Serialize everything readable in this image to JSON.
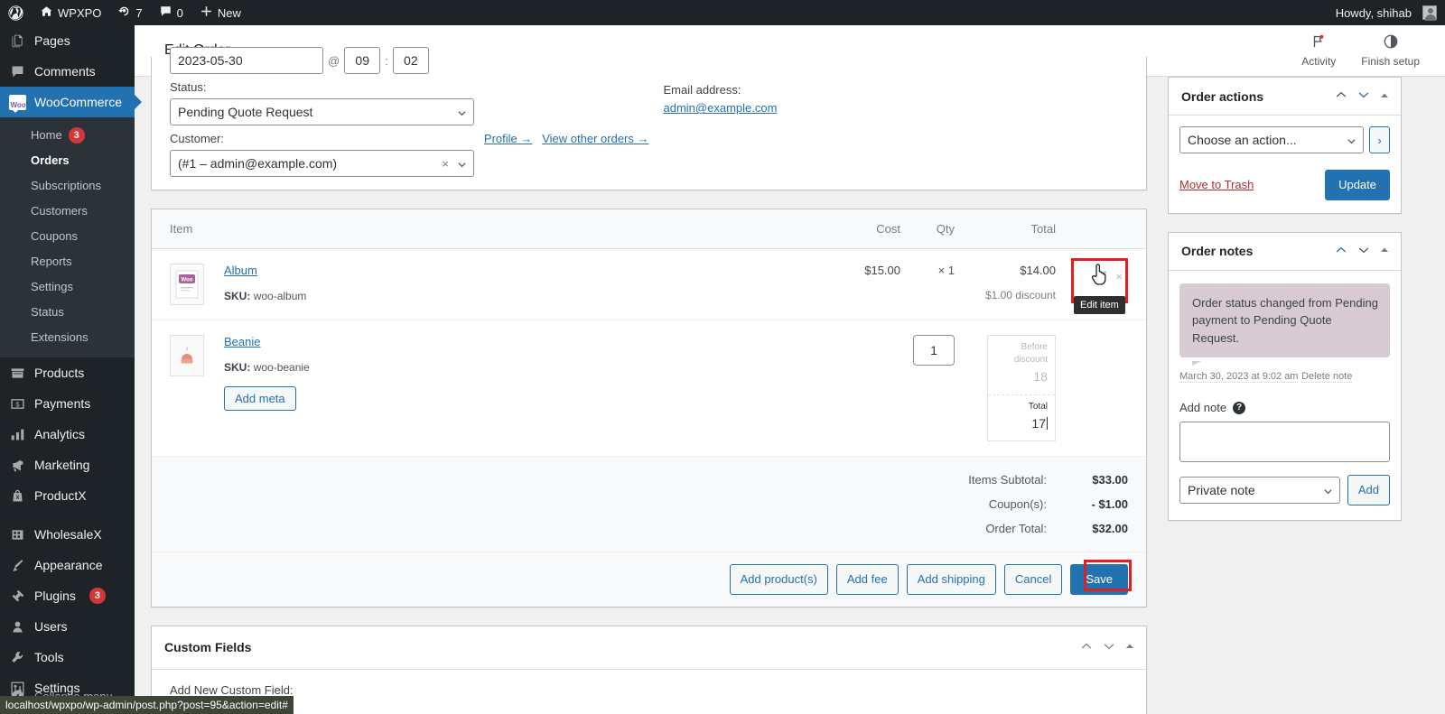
{
  "adminbar": {
    "logo_icon": "wordpress-logo-icon",
    "site_name": "WPXPO",
    "updates_count": "7",
    "comments_count": "0",
    "new_label": "New",
    "howdy": "Howdy, shihab"
  },
  "sidebar": {
    "top_items": [
      {
        "label": "Pages",
        "icon": "pages-icon"
      },
      {
        "label": "Comments",
        "icon": "comments-icon"
      }
    ],
    "woocommerce": {
      "label": "WooCommerce",
      "icon": "woo-icon",
      "submenu": [
        {
          "label": "Home",
          "badge": "3"
        },
        {
          "label": "Orders",
          "badge": ""
        },
        {
          "label": "Subscriptions",
          "badge": ""
        },
        {
          "label": "Customers",
          "badge": ""
        },
        {
          "label": "Coupons",
          "badge": ""
        },
        {
          "label": "Reports",
          "badge": ""
        },
        {
          "label": "Settings",
          "badge": ""
        },
        {
          "label": "Status",
          "badge": ""
        },
        {
          "label": "Extensions",
          "badge": ""
        }
      ]
    },
    "bottom_items": [
      {
        "label": "Products",
        "icon": "products-icon",
        "badge": ""
      },
      {
        "label": "Payments",
        "icon": "payments-icon",
        "badge": ""
      },
      {
        "label": "Analytics",
        "icon": "analytics-icon",
        "badge": ""
      },
      {
        "label": "Marketing",
        "icon": "marketing-icon",
        "badge": ""
      },
      {
        "label": "ProductX",
        "icon": "productx-icon",
        "badge": ""
      },
      {
        "label": "WholesaleX",
        "icon": "wholesalex-icon",
        "badge": ""
      },
      {
        "label": "Appearance",
        "icon": "appearance-icon",
        "badge": ""
      },
      {
        "label": "Plugins",
        "icon": "plugins-icon",
        "badge": "3"
      },
      {
        "label": "Users",
        "icon": "users-icon",
        "badge": ""
      },
      {
        "label": "Tools",
        "icon": "tools-icon",
        "badge": ""
      },
      {
        "label": "Settings",
        "icon": "settings-icon",
        "badge": ""
      }
    ],
    "collapse_label": "Collapse menu"
  },
  "header": {
    "title": "Edit Order",
    "actions": [
      {
        "label": "Activity",
        "icon": "flag-icon"
      },
      {
        "label": "Finish setup",
        "icon": "half-circle-icon"
      }
    ]
  },
  "order_data": {
    "date_value": "2023-05-30",
    "time_hour": "09",
    "time_minute": "02",
    "time_separator": "@",
    "time_colon": ":",
    "status_label": "Status:",
    "status_value": "Pending Quote Request",
    "customer_label": "Customer:",
    "customer_value": "(#1 – admin@example.com)",
    "profile_link": "Profile →",
    "other_orders_link": "View other orders →",
    "email_label": "Email address:",
    "email_value": "admin@example.com"
  },
  "items": {
    "columns": {
      "item": "Item",
      "cost": "Cost",
      "qty": "Qty",
      "total": "Total"
    },
    "rows": [
      {
        "name": "Album",
        "sku_label": "SKU:",
        "sku": "woo-album",
        "cost": "$15.00",
        "qty": "× 1",
        "total": "$14.00",
        "discount": "$1.00 discount",
        "editing": false
      },
      {
        "name": "Beanie",
        "sku_label": "SKU:",
        "sku": "woo-beanie",
        "add_meta_label": "Add meta",
        "qty_value": "1",
        "before_discount_label": "Before discount",
        "before_discount_value": "18",
        "total_label": "Total",
        "total_value": "17",
        "editing": true
      }
    ],
    "tooltip": "Edit item",
    "edit_icon": "pencil-icon",
    "delete_icon": "x-icon",
    "totals": [
      {
        "label": "Items Subtotal:",
        "value": "$33.00"
      },
      {
        "label": "Coupon(s):",
        "value": "- $1.00"
      },
      {
        "label": "Order Total:",
        "value": "$32.00"
      }
    ],
    "buttons": [
      {
        "label": "Add product(s)",
        "primary": false
      },
      {
        "label": "Add fee",
        "primary": false
      },
      {
        "label": "Add shipping",
        "primary": false
      },
      {
        "label": "Cancel",
        "primary": false
      },
      {
        "label": "Save",
        "primary": true
      }
    ]
  },
  "custom_fields": {
    "title": "Custom Fields",
    "add_new_label": "Add New Custom Field:"
  },
  "order_actions": {
    "title": "Order actions",
    "select_value": "Choose an action...",
    "go_label": "›",
    "trash_label": "Move to Trash",
    "update_label": "Update"
  },
  "order_notes": {
    "title": "Order notes",
    "note_text": "Order status changed from Pending payment to Pending Quote Request.",
    "note_date": "March 30, 2023 at 9:02 am",
    "delete_label": "Delete note",
    "add_note_label": "Add note",
    "note_placeholder": "",
    "note_value": "",
    "note_type_value": "Private note",
    "add_button": "Add"
  },
  "statusbar": {
    "url": "localhost/wpxpo/wp-admin/post.php?post=95&action=edit#"
  },
  "colors": {
    "admin_bg": "#1d2327",
    "accent": "#2271b1",
    "highlight": "#e02020",
    "badge": "#d63638",
    "note_bubble": "#d7cad2"
  }
}
